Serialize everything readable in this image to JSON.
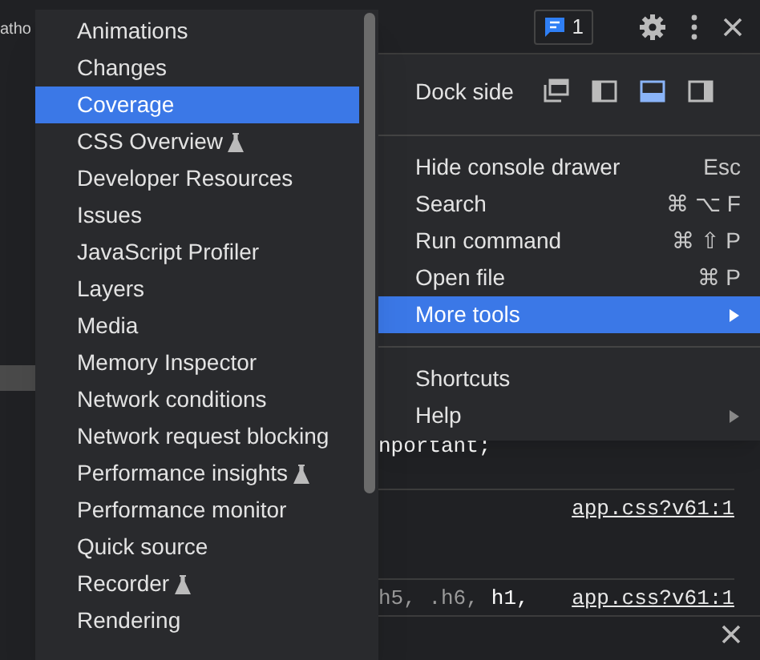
{
  "background": {
    "tab_text": "atho",
    "code_rows": [
      {
        "parts": [
          {
            "text": "nportant;",
            "dim": false
          }
        ]
      },
      {
        "link": "app.css?v61:1"
      },
      {
        "parts": [
          {
            "text": "h5, .h6,",
            "dim": true
          },
          {
            "text": "h1,",
            "dim": false
          }
        ],
        "link": "app.css?v61:1"
      }
    ]
  },
  "top_bar": {
    "issues_count": "1"
  },
  "main_menu": {
    "dock_side": {
      "label": "Dock side",
      "options": [
        {
          "kind": "undock",
          "selected": false
        },
        {
          "kind": "left",
          "selected": false
        },
        {
          "kind": "bottom",
          "selected": true
        },
        {
          "kind": "right",
          "selected": false
        }
      ]
    },
    "groups": [
      [
        {
          "label": "Hide console drawer",
          "shortcut": "Esc",
          "submenu": false,
          "selected": false
        },
        {
          "label": "Search",
          "shortcut": "⌘ ⌥ F",
          "submenu": false,
          "selected": false
        },
        {
          "label": "Run command",
          "shortcut": "⌘ ⇧ P",
          "submenu": false,
          "selected": false
        },
        {
          "label": "Open file",
          "shortcut": "⌘ P",
          "submenu": false,
          "selected": false
        },
        {
          "label": "More tools",
          "submenu": true,
          "selected": true
        }
      ],
      [
        {
          "label": "Shortcuts",
          "submenu": false,
          "selected": false
        },
        {
          "label": "Help",
          "submenu": true,
          "selected": false
        }
      ]
    ]
  },
  "more_tools_menu": {
    "items": [
      {
        "label": "Animations",
        "experimental": false,
        "selected": false
      },
      {
        "label": "Changes",
        "experimental": false,
        "selected": false
      },
      {
        "label": "Coverage",
        "experimental": false,
        "selected": true
      },
      {
        "label": "CSS Overview",
        "experimental": true,
        "selected": false
      },
      {
        "label": "Developer Resources",
        "experimental": false,
        "selected": false
      },
      {
        "label": "Issues",
        "experimental": false,
        "selected": false
      },
      {
        "label": "JavaScript Profiler",
        "experimental": false,
        "selected": false
      },
      {
        "label": "Layers",
        "experimental": false,
        "selected": false
      },
      {
        "label": "Media",
        "experimental": false,
        "selected": false
      },
      {
        "label": "Memory Inspector",
        "experimental": false,
        "selected": false
      },
      {
        "label": "Network conditions",
        "experimental": false,
        "selected": false
      },
      {
        "label": "Network request blocking",
        "experimental": false,
        "selected": false
      },
      {
        "label": "Performance insights",
        "experimental": true,
        "selected": false
      },
      {
        "label": "Performance monitor",
        "experimental": false,
        "selected": false
      },
      {
        "label": "Quick source",
        "experimental": false,
        "selected": false
      },
      {
        "label": "Recorder",
        "experimental": true,
        "selected": false
      },
      {
        "label": "Rendering",
        "experimental": false,
        "selected": false
      }
    ]
  }
}
